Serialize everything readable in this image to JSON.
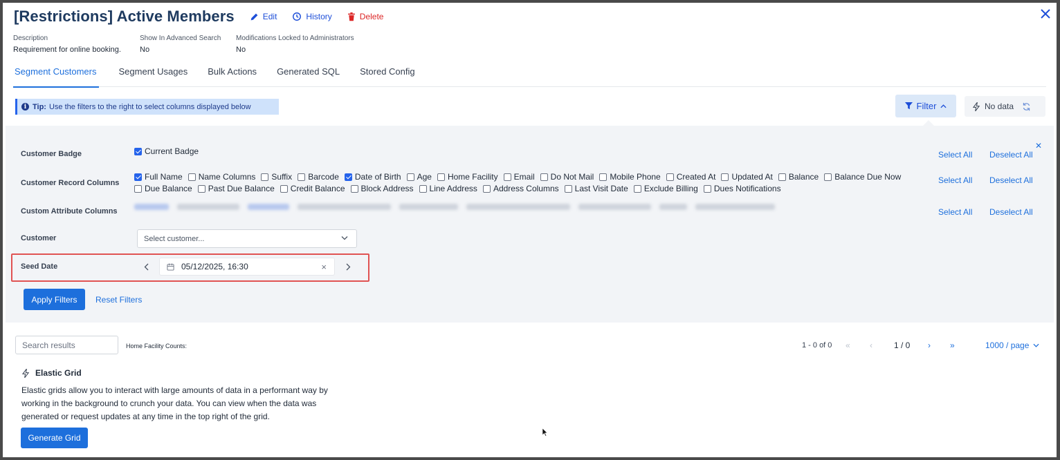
{
  "header": {
    "title": "[Restrictions] Active Members",
    "edit_label": "Edit",
    "history_label": "History",
    "delete_label": "Delete"
  },
  "meta": {
    "description_label": "Description",
    "description_value": "Requirement for online booking.",
    "advanced_search_label": "Show In Advanced Search",
    "advanced_search_value": "No",
    "locked_label": "Modifications Locked to Administrators",
    "locked_value": "No"
  },
  "tabs": [
    {
      "label": "Segment Customers",
      "active": true
    },
    {
      "label": "Segment Usages",
      "active": false
    },
    {
      "label": "Bulk Actions",
      "active": false
    },
    {
      "label": "Generated SQL",
      "active": false
    },
    {
      "label": "Stored Config",
      "active": false
    }
  ],
  "tip": {
    "bold": "Tip:",
    "text": "Use the filters to the right to select columns displayed below"
  },
  "toolbar": {
    "filter_label": "Filter",
    "nodata_label": "No data"
  },
  "filters": {
    "select_all": "Select All",
    "deselect_all": "Deselect All",
    "badge_label": "Customer Badge",
    "badge_options": [
      {
        "label": "Current Badge",
        "checked": true
      }
    ],
    "record_label": "Customer Record Columns",
    "record_row1": [
      {
        "label": "Full Name",
        "checked": true
      },
      {
        "label": "Name Columns",
        "checked": false
      },
      {
        "label": "Suffix",
        "checked": false
      },
      {
        "label": "Barcode",
        "checked": false
      },
      {
        "label": "Date of Birth",
        "checked": true
      },
      {
        "label": "Age",
        "checked": false
      },
      {
        "label": "Home Facility",
        "checked": false
      },
      {
        "label": "Email",
        "checked": false
      },
      {
        "label": "Do Not Mail",
        "checked": false
      },
      {
        "label": "Mobile Phone",
        "checked": false
      },
      {
        "label": "Created At",
        "checked": false
      },
      {
        "label": "Updated At",
        "checked": false
      },
      {
        "label": "Balance",
        "checked": false
      },
      {
        "label": "Balance Due Now",
        "checked": false
      }
    ],
    "record_row2": [
      {
        "label": "Due Balance",
        "checked": false
      },
      {
        "label": "Past Due Balance",
        "checked": false
      },
      {
        "label": "Credit Balance",
        "checked": false
      },
      {
        "label": "Block Address",
        "checked": false
      },
      {
        "label": "Line Address",
        "checked": false
      },
      {
        "label": "Address Columns",
        "checked": false
      },
      {
        "label": "Last Visit Date",
        "checked": false
      },
      {
        "label": "Exclude Billing",
        "checked": false
      },
      {
        "label": "Dues Notifications",
        "checked": false
      }
    ],
    "custom_label": "Custom Attribute Columns",
    "customer_label": "Customer",
    "customer_placeholder": "Select customer...",
    "seed_label": "Seed Date",
    "seed_value": "05/12/2025, 16:30",
    "apply_label": "Apply Filters",
    "reset_label": "Reset Filters"
  },
  "results": {
    "search_placeholder": "Search results",
    "home_facility_counts": "Home Facility Counts:",
    "range_text": "1 - 0 of 0",
    "page_text": "1 / 0",
    "per_page": "1000 / page"
  },
  "elastic": {
    "title": "Elastic Grid",
    "description": "Elastic grids allow you to interact with large amounts of data in a performant way by working in the background to crunch your data. You can view when the data was generated or request updates at any time in the top right of the grid.",
    "button_label": "Generate Grid"
  },
  "colors": {
    "accent": "#1d6fdc",
    "danger": "#dc2626",
    "tip_bg": "#cfe2fb",
    "panel_bg": "#f2f4f7",
    "highlight": "#e05252"
  }
}
